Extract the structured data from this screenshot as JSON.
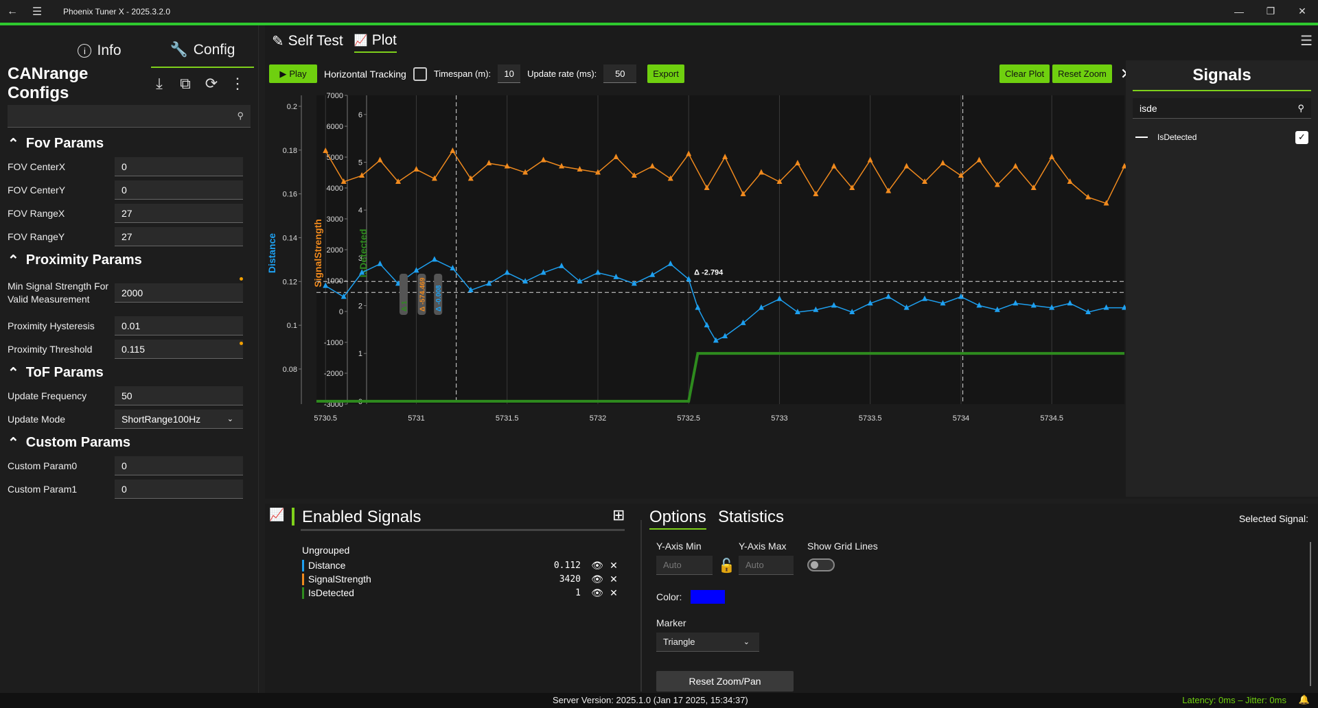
{
  "window": {
    "title": "Phoenix Tuner X - 2025.3.2.0"
  },
  "left": {
    "tabs": [
      {
        "label": "Info"
      },
      {
        "label": "Config"
      }
    ],
    "configs_title": "CANrange Configs",
    "search_value": "",
    "groups": [
      {
        "title": "Fov Params",
        "rows": [
          {
            "label": "FOV CenterX",
            "value": "0"
          },
          {
            "label": "FOV CenterY",
            "value": "0"
          },
          {
            "label": "FOV RangeX",
            "value": "27"
          },
          {
            "label": "FOV RangeY",
            "value": "27"
          }
        ]
      },
      {
        "title": "Proximity Params",
        "rows": [
          {
            "label": "Min Signal Strength For Valid Measurement",
            "value": "2000"
          },
          {
            "label": "Proximity Hysteresis",
            "value": "0.01"
          },
          {
            "label": "Proximity Threshold",
            "value": "0.115"
          }
        ]
      },
      {
        "title": "ToF Params",
        "rows": [
          {
            "label": "Update Frequency",
            "value": "50"
          },
          {
            "label": "Update Mode",
            "value": "ShortRange100Hz"
          }
        ]
      },
      {
        "title": "Custom Params",
        "rows": [
          {
            "label": "Custom Param0",
            "value": "0"
          },
          {
            "label": "Custom Param1",
            "value": "0"
          }
        ]
      }
    ]
  },
  "plot": {
    "tabs": [
      {
        "label": "Self Test"
      },
      {
        "label": "Plot"
      }
    ],
    "play_label": "Play",
    "horizontal_tracking_label": "Horizontal Tracking",
    "timespan_label": "Timespan (m):",
    "timespan_value": "10",
    "update_rate_label": "Update rate (ms):",
    "update_rate_value": "50",
    "export_label": "Export",
    "clear_plot_label": "Clear Plot",
    "reset_zoom_label": "Reset Zoom",
    "delta_label": "Δ -2.794",
    "cursor_labels": [
      "Δ 1",
      "Δ -574.469",
      "Δ -0.008"
    ],
    "colors": {
      "distance": "#1ea0f0",
      "signal_strength": "#f08a1e",
      "is_detected": "#2e8b1e"
    }
  },
  "signals_panel": {
    "title": "Signals",
    "search_value": "isde",
    "items": [
      {
        "label": "IsDetected",
        "checked": true
      }
    ]
  },
  "enabled_signals": {
    "title": "Enabled Signals",
    "group": "Ungrouped",
    "items": [
      {
        "name": "Distance",
        "value": "0.112",
        "color": "#1ea0f0"
      },
      {
        "name": "SignalStrength",
        "value": "3420",
        "color": "#f08a1e"
      },
      {
        "name": "IsDetected",
        "value": "1",
        "color": "#2e8b1e"
      }
    ]
  },
  "options": {
    "tabs": [
      {
        "label": "Options"
      },
      {
        "label": "Statistics"
      }
    ],
    "selected_signal_label": "Selected Signal:",
    "ymin_label": "Y-Axis Min",
    "ymin_placeholder": "Auto",
    "ymax_label": "Y-Axis Max",
    "ymax_placeholder": "Auto",
    "grid_label": "Show Grid Lines",
    "color_label": "Color:",
    "color_value": "#0000ff",
    "marker_label": "Marker",
    "marker_value": "Triangle",
    "reset_label": "Reset Zoom/Pan"
  },
  "status": {
    "server": "Server Version:  2025.1.0 (Jan 17 2025, 15:34:37)",
    "latency": "Latency: 0ms – Jitter: 0ms"
  },
  "chart_data": {
    "type": "line",
    "xlabel": "",
    "x_ticks": [
      "5730.5",
      "5731",
      "5731.5",
      "5732",
      "5732.5",
      "5733",
      "5733.5",
      "5734",
      "5734.5"
    ],
    "xlim": [
      5730.45,
      5734.9
    ],
    "axes": [
      {
        "label": "Distance",
        "ticks": [
          "0.2",
          "0.18",
          "0.16",
          "0.14",
          "0.12",
          "0.1",
          "0.08"
        ],
        "ylim": [
          0.064,
          0.205
        ]
      },
      {
        "label": "SignalStrength",
        "ticks": [
          "7000",
          "6000",
          "5000",
          "4000",
          "3000",
          "2000",
          "1000",
          "0",
          "-1000",
          "-2000",
          "-3000"
        ],
        "ylim": [
          -3000,
          7000
        ]
      },
      {
        "label": "IsDetected",
        "ticks": [
          "6",
          "5",
          "4",
          "3",
          "2",
          "1",
          "-0"
        ],
        "ylim": [
          -0.06,
          6.4
        ]
      }
    ],
    "series": [
      {
        "name": "Distance",
        "x": [
          5730.5,
          5730.6,
          5730.7,
          5730.8,
          5730.9,
          5731.0,
          5731.1,
          5731.2,
          5731.3,
          5731.4,
          5731.5,
          5731.6,
          5731.7,
          5731.8,
          5731.9,
          5732.0,
          5732.1,
          5732.2,
          5732.3,
          5732.4,
          5732.5,
          5732.55,
          5732.6,
          5732.65,
          5732.7,
          5732.8,
          5732.9,
          5733.0,
          5733.1,
          5733.2,
          5733.3,
          5733.4,
          5733.5,
          5733.6,
          5733.7,
          5733.8,
          5733.9,
          5734.0,
          5734.1,
          5734.2,
          5734.3,
          5734.4,
          5734.5,
          5734.6,
          5734.7,
          5734.8,
          5734.9
        ],
        "values": [
          0.118,
          0.113,
          0.124,
          0.128,
          0.119,
          0.125,
          0.13,
          0.126,
          0.116,
          0.119,
          0.124,
          0.12,
          0.124,
          0.127,
          0.12,
          0.124,
          0.122,
          0.119,
          0.123,
          0.128,
          0.121,
          0.108,
          0.1,
          0.093,
          0.095,
          0.101,
          0.108,
          0.112,
          0.106,
          0.107,
          0.109,
          0.106,
          0.11,
          0.113,
          0.108,
          0.112,
          0.11,
          0.113,
          0.109,
          0.107,
          0.11,
          0.109,
          0.108,
          0.11,
          0.106,
          0.108,
          0.108
        ]
      },
      {
        "name": "SignalStrength",
        "x": [
          5730.5,
          5730.6,
          5730.7,
          5730.8,
          5730.9,
          5731.0,
          5731.1,
          5731.2,
          5731.3,
          5731.4,
          5731.5,
          5731.6,
          5731.7,
          5731.8,
          5731.9,
          5732.0,
          5732.1,
          5732.2,
          5732.3,
          5732.4,
          5732.5,
          5732.6,
          5732.7,
          5732.8,
          5732.9,
          5733.0,
          5733.1,
          5733.2,
          5733.3,
          5733.4,
          5733.5,
          5733.6,
          5733.7,
          5733.8,
          5733.9,
          5734.0,
          5734.1,
          5734.2,
          5734.3,
          5734.4,
          5734.5,
          5734.6,
          5734.7,
          5734.8,
          5734.9
        ],
        "values": [
          5200,
          4200,
          4400,
          4900,
          4200,
          4600,
          4300,
          5200,
          4300,
          4800,
          4700,
          4500,
          4900,
          4700,
          4600,
          4500,
          5000,
          4400,
          4700,
          4300,
          5100,
          4000,
          5000,
          3800,
          4500,
          4200,
          4800,
          3800,
          4700,
          4000,
          4900,
          3900,
          4700,
          4200,
          4800,
          4400,
          4900,
          4100,
          4700,
          4000,
          5000,
          4200,
          3700,
          3500,
          4700
        ]
      },
      {
        "name": "IsDetected",
        "x": [
          5730.45,
          5732.5,
          5732.55,
          5734.9
        ],
        "values": [
          0,
          0,
          1,
          1
        ]
      }
    ]
  }
}
